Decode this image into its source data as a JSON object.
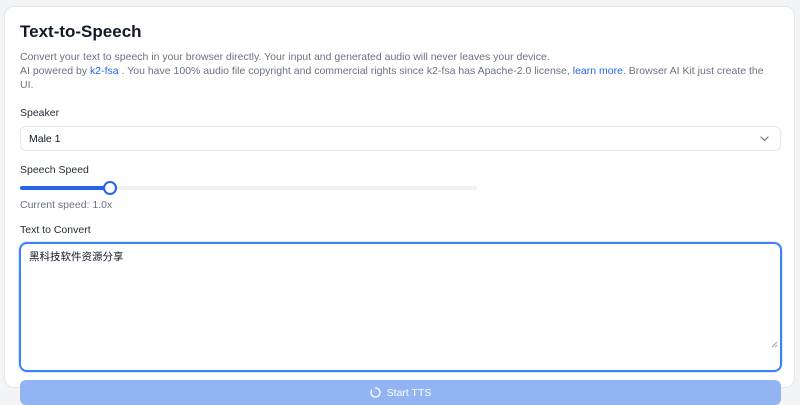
{
  "title": "Text-to-Speech",
  "description": {
    "line1": "Convert your text to speech in your browser directly. Your input and generated audio will never leaves your device.",
    "line2_prefix": "AI powered by ",
    "link_k2fsa": "k2-fsa",
    "line2_middle": " . You have 100% audio file copyright and commercial rights since k2-fsa has Apache-2.0 license, ",
    "link_learn_more": "learn more",
    "line2_suffix": ". Browser AI Kit just create the UI."
  },
  "speaker": {
    "label": "Speaker",
    "selected": "Male 1",
    "icon": "chevron-down-icon"
  },
  "speed": {
    "label": "Speech Speed",
    "fraction": 0.197,
    "current_text": "Current speed: 1.0x"
  },
  "text_input": {
    "label": "Text to Convert",
    "value": "黑科技软件资源分享"
  },
  "start_button": {
    "label": "Start TTS",
    "icon": "spinner-icon"
  },
  "colors": {
    "accent": "#2563eb",
    "button_disabled": "#93b4f3",
    "muted_text": "#6b7280"
  }
}
